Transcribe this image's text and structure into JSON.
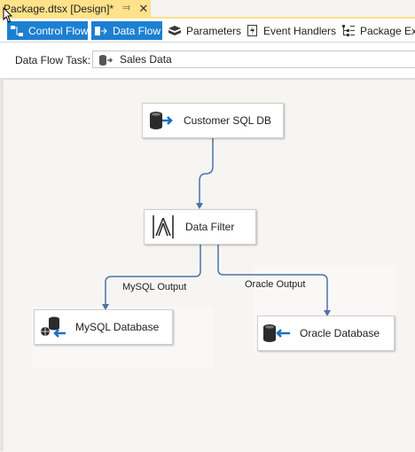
{
  "document_tab": {
    "title": "Package.dtsx [Design]*",
    "pin_icon": "pin-icon",
    "close_icon": "close-icon"
  },
  "toolbar": {
    "tabs": [
      {
        "label": "Control Flow",
        "icon": "control-flow-icon",
        "active": true
      },
      {
        "label": "Data Flow",
        "icon": "data-flow-icon",
        "active": true
      },
      {
        "label": "Parameters",
        "icon": "parameters-icon",
        "active": false
      },
      {
        "label": "Event Handlers",
        "icon": "event-handlers-icon",
        "active": false
      },
      {
        "label": "Package Expl",
        "icon": "package-explorer-icon",
        "active": false
      }
    ]
  },
  "task": {
    "label": "Data Flow Task:",
    "value": "Sales Data",
    "icon": "data-flow-task-icon"
  },
  "components": [
    {
      "label": "Customer SQL DB",
      "icon": "source-icon"
    },
    {
      "label": "Data Filter",
      "icon": "conditional-split-icon"
    },
    {
      "label": "MySQL Database",
      "icon": "destination-icon"
    },
    {
      "label": "Oracle Database",
      "icon": "destination-icon"
    }
  ],
  "paths": [
    {
      "label": "MySQL Output"
    },
    {
      "label": "Oracle Output"
    }
  ],
  "colors": {
    "accent": "#1c7fd1",
    "tab": "#ffe28a",
    "path": "#4a73a8"
  }
}
